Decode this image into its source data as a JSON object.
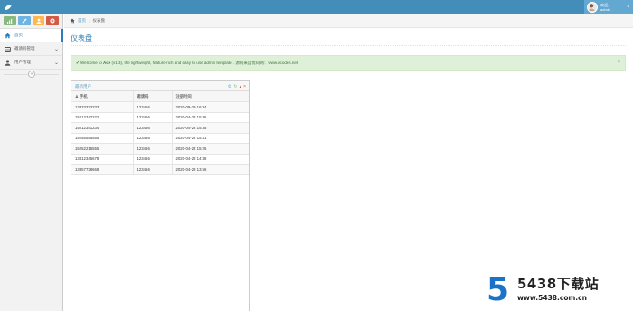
{
  "header": {
    "user_greeting": "欢迎,",
    "user_name": "admin"
  },
  "sidebar": {
    "shortcut_colors": [
      "#87B87F",
      "#6FB3E0",
      "#FFB752",
      "#D15B47"
    ],
    "items": [
      {
        "label": "首页",
        "icon": "home-icon",
        "active": true
      },
      {
        "label": "邀请码管理",
        "icon": "hdd-icon",
        "has_arrow": true
      },
      {
        "label": "用户管理",
        "icon": "user-icon",
        "has_arrow": true
      }
    ]
  },
  "breadcrumb": {
    "home": "首页",
    "current": "仪表盘"
  },
  "page": {
    "title": "仪表盘"
  },
  "alert": {
    "prefix": "Welcome to ",
    "brand": "Ace",
    "version": " (v1.3)",
    "text": ", the lightweight, feature-rich and easy to use admin template . 源码来自优码网：www.ucodes.net"
  },
  "widget": {
    "title": "最新用户",
    "columns": [
      "手机",
      "邀请码",
      "注册时间"
    ],
    "rows": [
      [
        "13333333333",
        "123456",
        "2020-09-29 16:34"
      ],
      [
        "15212342222",
        "123456",
        "2020-04-22 15:36"
      ],
      [
        "15212341234",
        "123456",
        "2020-04-22 15:35"
      ],
      [
        "15255555555",
        "123456",
        "2020-04-22 15:31"
      ],
      [
        "15252215555",
        "123456",
        "2020-04-22 15:25"
      ],
      [
        "13812345678",
        "123456",
        "2020-04-22 14:38"
      ],
      [
        "13357738668",
        "123456",
        "2020-04-22 13:56"
      ]
    ]
  },
  "watermark": {
    "digit": "5",
    "brand": "5438下载站",
    "url": "www.5438.com.cn"
  }
}
